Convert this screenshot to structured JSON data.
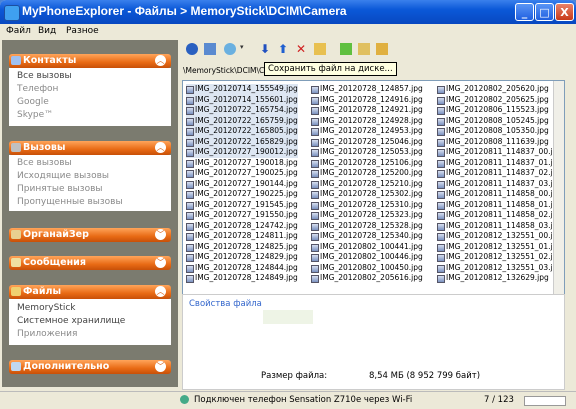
{
  "window": {
    "title": "MyPhoneExplorer -  Файлы > MemoryStick\\DCIM\\Camera",
    "minimize": "_",
    "maximize": "□",
    "close": "X"
  },
  "menu": [
    "Файл",
    "Вид",
    "Разное"
  ],
  "sidebar": {
    "contacts": {
      "header": "Контакты",
      "items": [
        "Все вызовы",
        "Телефон",
        "Google",
        "Skype™"
      ]
    },
    "calls": {
      "header": "Вызовы",
      "items": [
        "Все вызовы",
        "Исходящие вызовы",
        "Принятые вызовы",
        "Пропущенные вызовы"
      ]
    },
    "organizer": {
      "header": "ОрганайЗер"
    },
    "messages": {
      "header": "Сообщения"
    },
    "files": {
      "header": "Файлы",
      "items": [
        "MemoryStick",
        "Системное хранилище",
        "Приложения"
      ]
    },
    "extra": {
      "header": "Дополнительно"
    }
  },
  "path": "\\MemoryStick\\DCIM\\Camera",
  "tooltip": "Сохранить файл на диске...",
  "files": {
    "col1": [
      "IMG_20120714_155549.jpg",
      "IMG_20120714_155601.jpg",
      "IMG_20120722_165754.jpg",
      "IMG_20120722_165759.jpg",
      "IMG_20120722_165805.jpg",
      "IMG_20120722_165829.jpg",
      "IMG_20120727_190012.jpg",
      "IMG_20120727_190018.jpg",
      "IMG_20120727_190025.jpg",
      "IMG_20120727_190144.jpg",
      "IMG_20120727_190225.jpg",
      "IMG_20120727_191545.jpg",
      "IMG_20120727_191550.jpg",
      "IMG_20120728_124742.jpg",
      "IMG_20120728_124811.jpg",
      "IMG_20120728_124825.jpg",
      "IMG_20120728_124829.jpg",
      "IMG_20120728_124844.jpg",
      "IMG_20120728_124849.jpg"
    ],
    "col2": [
      "IMG_20120728_124857.jpg",
      "IMG_20120728_124916.jpg",
      "IMG_20120728_124921.jpg",
      "IMG_20120728_124928.jpg",
      "IMG_20120728_124953.jpg",
      "IMG_20120728_125046.jpg",
      "IMG_20120728_125053.jpg",
      "IMG_20120728_125106.jpg",
      "IMG_20120728_125200.jpg",
      "IMG_20120728_125210.jpg",
      "IMG_20120728_125302.jpg",
      "IMG_20120728_125310.jpg",
      "IMG_20120728_125323.jpg",
      "IMG_20120728_125328.jpg",
      "IMG_20120728_125340.jpg",
      "IMG_20120802_100441.jpg",
      "IMG_20120802_100446.jpg",
      "IMG_20120802_100450.jpg",
      "IMG_20120802_205616.jpg"
    ],
    "col3": [
      "IMG_20120802_205620.jpg",
      "IMG_20120802_205625.jpg",
      "IMG_20120806_115523.jpg",
      "IMG_20120808_105245.jpg",
      "IMG_20120808_105350.jpg",
      "IMG_20120808_111639.jpg",
      "IMG_20120811_114837_00.jpg",
      "IMG_20120811_114837_01.jpg",
      "IMG_20120811_114837_02.jpg",
      "IMG_20120811_114837_03.jpg",
      "IMG_20120811_114858_00.jpg",
      "IMG_20120811_114858_01.jpg",
      "IMG_20120811_114858_02.jpg",
      "IMG_20120811_114858_03.jpg",
      "IMG_20120812_132551_00.jpg",
      "IMG_20120812_132551_01.jpg",
      "IMG_20120812_132551_02.jpg",
      "IMG_20120812_132551_03.jpg",
      "IMG_20120812_132629.jpg"
    ]
  },
  "props": {
    "title": "Свойства файла",
    "size_label": "Размер файла:",
    "size_value": "8,54 МБ     (8 952 799 байт)"
  },
  "status": {
    "text": "Подключен телефон Sensation Z710e через Wi-Fi",
    "count": "7 / 123"
  }
}
